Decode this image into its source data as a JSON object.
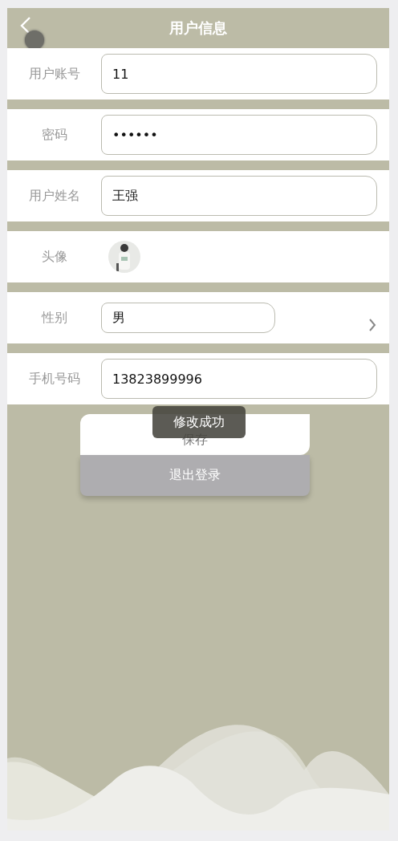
{
  "header": {
    "title": "用户信息"
  },
  "fields": [
    {
      "kind": "input",
      "label": "用户账号",
      "value": "11"
    },
    {
      "kind": "input",
      "label": "密码",
      "value": "••••••"
    },
    {
      "kind": "input",
      "label": "用户姓名",
      "value": "王强"
    },
    {
      "kind": "avatar",
      "label": "头像"
    },
    {
      "kind": "select",
      "label": "性别",
      "value": "男"
    },
    {
      "kind": "input",
      "label": "手机号码",
      "value": "13823899996"
    }
  ],
  "buttons": [
    {
      "kind": "primary",
      "label": "保存"
    },
    {
      "kind": "secondary",
      "label": "退出登录"
    }
  ],
  "toast": {
    "text": "修改成功"
  }
}
